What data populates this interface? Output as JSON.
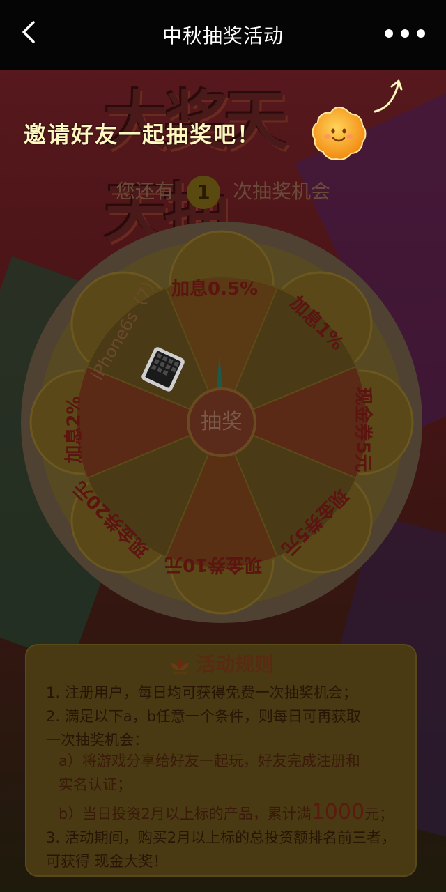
{
  "header": {
    "title": "中秋抽奖活动",
    "back_icon": "chevron-left-icon",
    "more_icon": "more-dots-icon"
  },
  "hero": {
    "big_text": "大奖天天抽"
  },
  "invite": {
    "text": "邀请好友一起抽奖吧！"
  },
  "chances": {
    "prefix": "您还有",
    "count": "1",
    "suffix": "次抽奖机会"
  },
  "wheel": {
    "center_label": "抽奖",
    "prizes": [
      {
        "label": "加息0.5%"
      },
      {
        "label": "加息1%"
      },
      {
        "label": "现金券5元"
      },
      {
        "label": "现金券5元"
      },
      {
        "label": "现金券10元"
      },
      {
        "label": "现金券20元"
      },
      {
        "label": "加息2%"
      },
      {
        "label": "iPhone6s（7）"
      }
    ]
  },
  "rules": {
    "title": "活动规则",
    "lines": [
      {
        "text": "1. 注册用户，每日均可获得免费一次抽奖机会；"
      },
      {
        "text": "2. 满足以下a，b任意一个条件，则每日可再获取"
      },
      {
        "text": "一次抽奖机会："
      },
      {
        "text": "a）将游戏分享给好友一起玩，好友完成注册和"
      },
      {
        "text": "实名认证；"
      },
      {
        "pre": "b）当日投资2月以上标的产品，累计满",
        "big": "1000",
        "post": "元；"
      },
      {
        "text": "3. 活动期间，购买2月以上标的总投资额排名前三者，"
      },
      {
        "text": "可获得 现金大奖！"
      }
    ]
  },
  "colors": {
    "header_bg": "#050505",
    "accent": "#fff7c0"
  }
}
